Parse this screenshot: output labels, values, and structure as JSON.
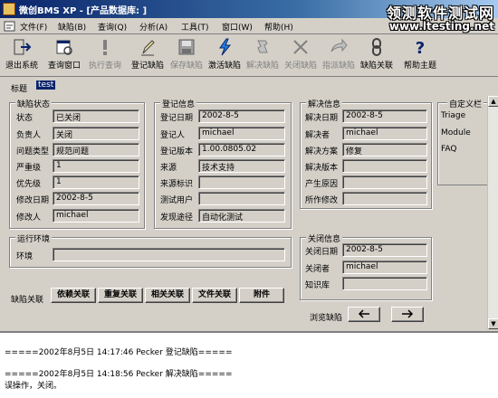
{
  "window": {
    "title": "微创BMS XP - [产品数据库: ]"
  },
  "watermark": {
    "line1": "领测软件测试网",
    "line2": "www.ltesting.net"
  },
  "menu": [
    "文件(F)",
    "缺陷(B)",
    "查询(Q)",
    "分析(A)",
    "工具(T)",
    "窗口(W)",
    "帮助(H)"
  ],
  "toolbar": [
    {
      "label": "退出系统",
      "icon": "exit-icon",
      "enabled": true
    },
    {
      "label": "查询窗口",
      "icon": "query-window-icon",
      "enabled": true
    },
    {
      "label": "执行查询",
      "icon": "run-query-icon",
      "enabled": false
    },
    {
      "label": "登记缺陷",
      "icon": "register-bug-icon",
      "enabled": true
    },
    {
      "label": "保存缺陷",
      "icon": "save-icon",
      "enabled": false
    },
    {
      "label": "激活缺陷",
      "icon": "activate-icon",
      "enabled": true
    },
    {
      "label": "解决缺陷",
      "icon": "resolve-icon",
      "enabled": false
    },
    {
      "label": "关闭缺陷",
      "icon": "close-icon",
      "enabled": false
    },
    {
      "label": "指派缺陷",
      "icon": "assign-icon",
      "enabled": false
    },
    {
      "label": "缺陷关联",
      "icon": "link-icon",
      "enabled": true
    },
    {
      "label": "帮助主题",
      "icon": "help-icon",
      "enabled": true
    }
  ],
  "form": {
    "title_label": "标题",
    "title_value": "test",
    "bug_status": {
      "legend": "缺陷状态",
      "fields": [
        {
          "label": "状态",
          "value": "已关闭"
        },
        {
          "label": "负责人",
          "value": "关闭"
        },
        {
          "label": "问题类型",
          "value": "规范问题"
        },
        {
          "label": "严重级",
          "value": "1"
        },
        {
          "label": "优先级",
          "value": "1"
        },
        {
          "label": "修改日期",
          "value": "2002-8-5"
        },
        {
          "label": "修改人",
          "value": "michael"
        }
      ]
    },
    "register_info": {
      "legend": "登记信息",
      "fields": [
        {
          "label": "登记日期",
          "value": "2002-8-5"
        },
        {
          "label": "登记人",
          "value": "michael"
        },
        {
          "label": "登记版本",
          "value": "1.00.0805.02"
        },
        {
          "label": "来源",
          "value": "技术支持"
        },
        {
          "label": "来源标识",
          "value": ""
        },
        {
          "label": "测试用户",
          "value": ""
        },
        {
          "label": "发现途径",
          "value": "自动化测试"
        }
      ]
    },
    "resolve_info": {
      "legend": "解决信息",
      "fields": [
        {
          "label": "解决日期",
          "value": "2002-8-5"
        },
        {
          "label": "解决者",
          "value": "michael"
        },
        {
          "label": "解决方案",
          "value": "修复"
        },
        {
          "label": "解决版本",
          "value": ""
        },
        {
          "label": "产生原因",
          "value": ""
        },
        {
          "label": "所作修改",
          "value": ""
        }
      ]
    },
    "custom_bar": {
      "legend": "自定义栏",
      "items": [
        "Triage",
        "Module",
        "FAQ"
      ]
    },
    "runtime_env": {
      "legend": "运行环境",
      "env_label": "环境",
      "env_value": ""
    },
    "close_info": {
      "legend": "关闭信息",
      "fields": [
        {
          "label": "关闭日期",
          "value": "2002-8-5"
        },
        {
          "label": "关闭者",
          "value": "michael"
        },
        {
          "label": "知识库",
          "value": ""
        }
      ]
    },
    "link_label": "缺陷关联",
    "link_buttons": [
      "依赖关联",
      "重复关联",
      "相关关联",
      "文件关联",
      "附件"
    ],
    "browse_label": "浏览缺陷"
  },
  "log": [
    "=====2002年8月5日 14:17:46 Pecker 登记缺陷=====",
    "=====2002年8月5日 14:18:56 Pecker 解决缺陷=====",
    "误操作，关闭。"
  ]
}
